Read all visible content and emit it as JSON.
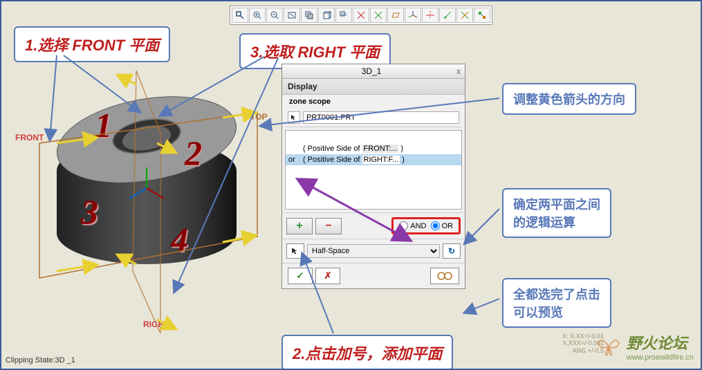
{
  "toolbar": {
    "icons": [
      "zoom-fit",
      "zoom-in",
      "zoom-out",
      "refit",
      "shade",
      "wireframe",
      "annotate",
      "dim1",
      "dim2",
      "plane",
      "csys",
      "axis",
      "curve",
      "point",
      "network"
    ]
  },
  "callouts": {
    "c1": "1.选择 FRONT 平面",
    "c3": "3.选取 RIGHT 平面",
    "c_yellow": "调整黄色箭头的方向",
    "c_logic_a": "确定两平面之间",
    "c_logic_b": "的逻辑运算",
    "c_preview_a": "全都选完了点击",
    "c_preview_b": "可以预览",
    "c2": "2.点击加号，添加平面"
  },
  "viewport": {
    "nums": {
      "n1": "1",
      "n2": "2",
      "n3": "3",
      "n4": "4"
    },
    "datums": {
      "front": "FRONT",
      "top": "TOP",
      "right": "RIGHT"
    },
    "clip_state": "Clipping State:3D _1"
  },
  "dialog": {
    "title": "3D_1",
    "close": "x",
    "display_hdr": "Display",
    "zone_hdr": "zone scope",
    "scope_value": "PRT0001.PRT",
    "rows": [
      {
        "op": "",
        "open": "(",
        "side": "Positive Side of",
        "ref": "FRONT:...",
        "close": ")"
      },
      {
        "op": "or",
        "open": "(",
        "side": "Positive Side of",
        "ref": "RIGHT:F...",
        "close": ")"
      }
    ],
    "plus": "+",
    "minus": "−",
    "and_label": "AND",
    "or_label": "OR",
    "halfspace": "Half-Space",
    "ok": "✓",
    "cancel": "✗",
    "preview": "👓"
  },
  "coords": {
    "l1": "X: X.XX+/-0.01",
    "l2": "X.XXX+/-0.001",
    "l3": "ANG.+/-0.5"
  },
  "watermark": {
    "title": "野火论坛",
    "url": "www.proewildfire.cn"
  }
}
